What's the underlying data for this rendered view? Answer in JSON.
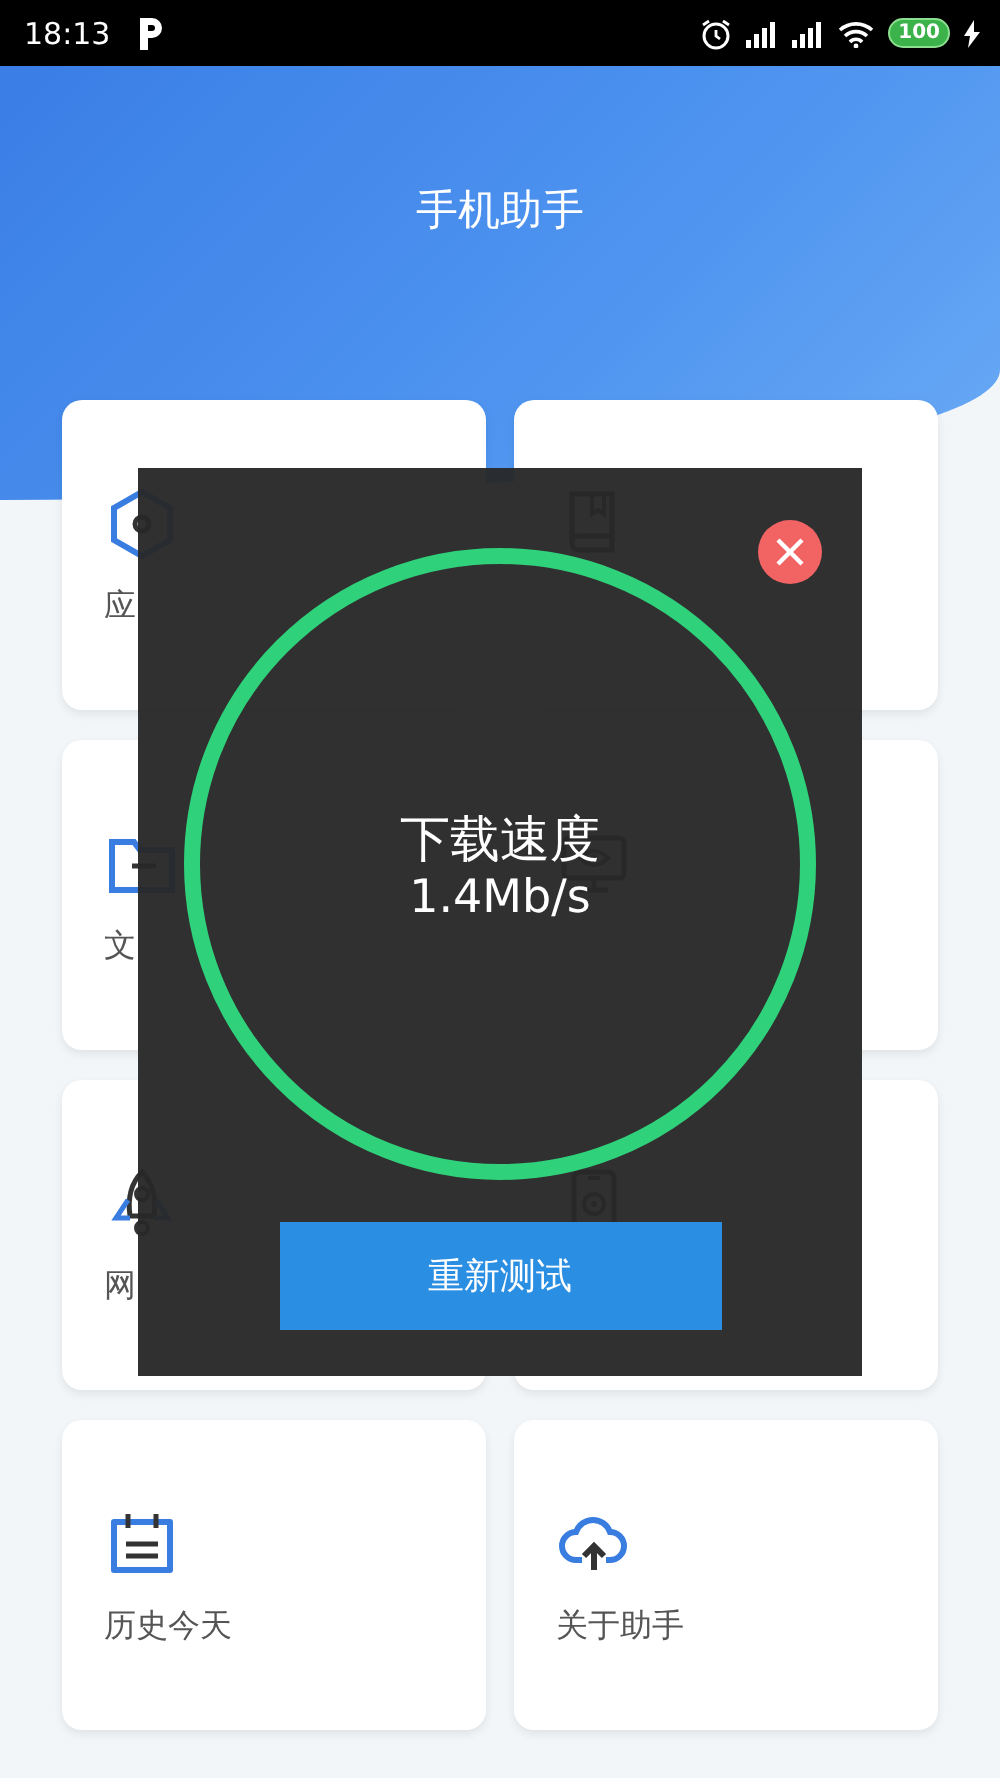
{
  "status_bar": {
    "time": "18:13",
    "battery": "100"
  },
  "header": {
    "title": "手机助手"
  },
  "tiles": [
    {
      "kind": "hexagon",
      "label": "应"
    },
    {
      "kind": "book"
    },
    {
      "kind": "folder",
      "label": "文"
    },
    {
      "kind": "monitor"
    },
    {
      "kind": "rocket",
      "label": "网"
    },
    {
      "kind": "phone"
    },
    {
      "kind": "calendar",
      "label": "历史今天"
    },
    {
      "kind": "cloud",
      "label": "关于助手"
    }
  ],
  "dialog": {
    "title": "下载速度",
    "speed": "1.4Mb/s",
    "button": "重新测试"
  }
}
